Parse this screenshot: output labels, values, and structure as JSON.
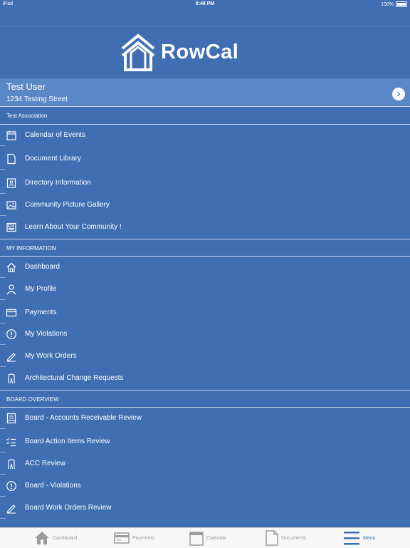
{
  "status": {
    "device": "iPad",
    "time": "8:48 PM",
    "battery": "100%"
  },
  "brand": {
    "name": "RowCal"
  },
  "user": {
    "name": "Test User",
    "address": "1234 Testing Street"
  },
  "sections": [
    {
      "title": "Test Association",
      "items": [
        {
          "label": "Calendar of Events",
          "icon": "calendar-icon"
        },
        {
          "label": "Document Library",
          "icon": "document-icon"
        },
        {
          "label": "Directory Information",
          "icon": "contact-card-icon"
        },
        {
          "label": "Community Picture Gallery",
          "icon": "image-icon"
        },
        {
          "label": "Learn About Your Community !",
          "icon": "newspaper-icon"
        }
      ]
    },
    {
      "title": "MY INFORMATION",
      "items": [
        {
          "label": "Dashboard",
          "icon": "home-icon"
        },
        {
          "label": "My Profile",
          "icon": "person-icon"
        },
        {
          "label": "Payments",
          "icon": "credit-card-icon"
        },
        {
          "label": "My Violations",
          "icon": "alert-icon"
        },
        {
          "label": "My Work Orders",
          "icon": "pencil-icon"
        },
        {
          "label": "Architectural Change Requests",
          "icon": "architecture-icon"
        }
      ]
    },
    {
      "title": "BOARD OVERVIEW",
      "items": [
        {
          "label": "Board - Accounts Receivable Review",
          "icon": "ledger-icon"
        },
        {
          "label": "Board Action Items Review",
          "icon": "checklist-icon"
        },
        {
          "label": "ACC Review",
          "icon": "architecture-icon"
        },
        {
          "label": "Board - Violations",
          "icon": "alert-icon"
        },
        {
          "label": "Board Work Orders Review",
          "icon": "pencil-icon"
        }
      ]
    }
  ],
  "tabs": [
    {
      "label": "Dashboard",
      "icon": "home-icon"
    },
    {
      "label": "Payments",
      "icon": "credit-card-icon"
    },
    {
      "label": "Calendar",
      "icon": "calendar-icon"
    },
    {
      "label": "Documents",
      "icon": "document-icon"
    },
    {
      "label": "Menu",
      "icon": "hamburger-icon",
      "active": true
    }
  ],
  "colors": {
    "background": "#3f6fb2",
    "user_bar": "#5a88c6",
    "active_tab": "#3f6fb2"
  }
}
